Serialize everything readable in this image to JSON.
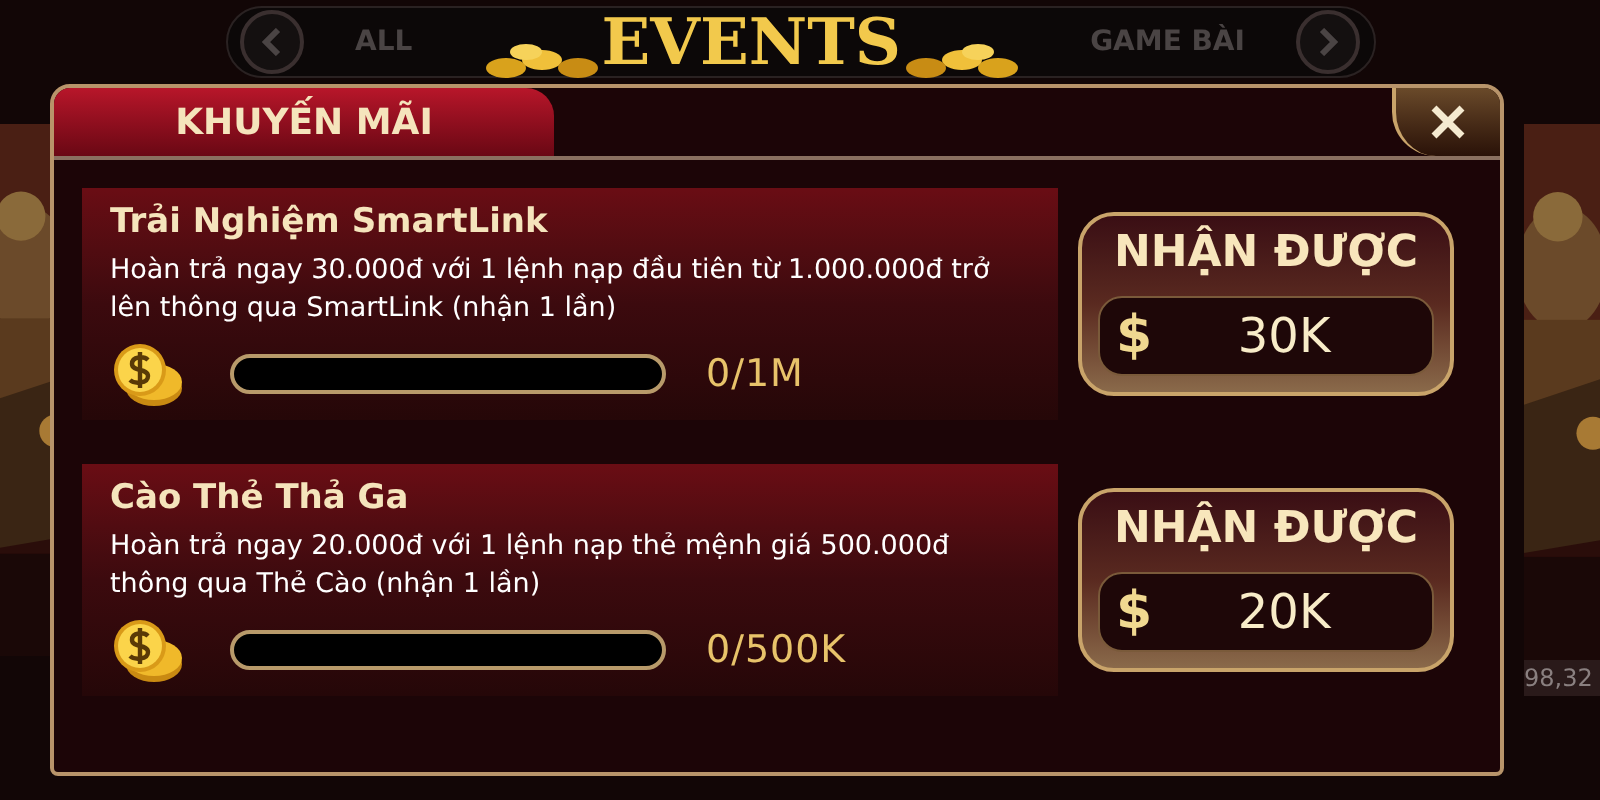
{
  "header": {
    "nav_left": "ALL",
    "title": "EVENTS",
    "nav_right": "GAME BÀI"
  },
  "tabs": [
    {
      "label": "KHUYẾN MÃI",
      "selected": true
    }
  ],
  "promotions": [
    {
      "title": "Trải Nghiệm SmartLink",
      "description": "Hoàn trả ngay 30.000đ với 1 lệnh nạp đầu tiên từ 1.000.000đ trở lên thông qua SmartLink (nhận 1 lần)",
      "level": 0,
      "progress": "0/1M",
      "reward_label": "NHẬN ĐƯỢC",
      "currency": "$",
      "reward": "30K"
    },
    {
      "title": "Cào Thẻ Thả Ga",
      "description": "Hoàn trả ngay 20.000đ với 1 lệnh nạp thẻ mệnh giá 500.000đ thông qua Thẻ Cào (nhận 1 lần)",
      "level": 0,
      "progress": "0/500K",
      "reward_label": "NHẬN ĐƯỢC",
      "currency": "$",
      "reward": "20K"
    }
  ],
  "background": {
    "card_value": "98,32"
  }
}
